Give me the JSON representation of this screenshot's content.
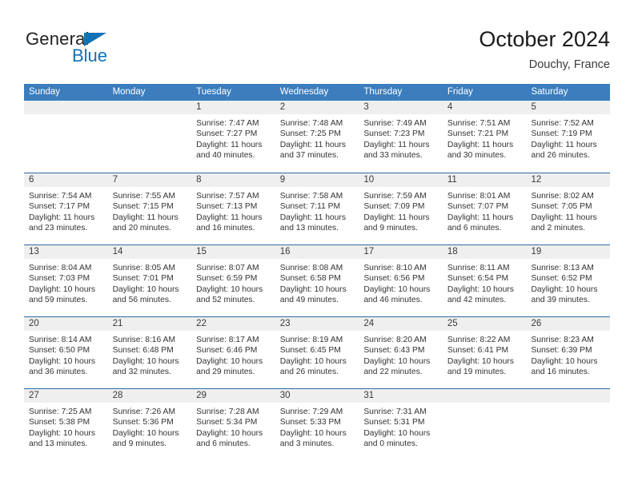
{
  "brand": {
    "name_part1": "General",
    "name_part2": "Blue",
    "accent_color": "#1272b6"
  },
  "header": {
    "title": "October 2024",
    "subtitle": "Douchy, France"
  },
  "theme": {
    "header_blue": "#3b7dbd",
    "row_divider_blue": "#2e6ca4",
    "day_band_gray": "#efefef"
  },
  "weekdays": [
    "Sunday",
    "Monday",
    "Tuesday",
    "Wednesday",
    "Thursday",
    "Friday",
    "Saturday"
  ],
  "weeks": [
    [
      {
        "day": "",
        "lines": []
      },
      {
        "day": "",
        "lines": []
      },
      {
        "day": "1",
        "lines": [
          "Sunrise: 7:47 AM",
          "Sunset: 7:27 PM",
          "Daylight: 11 hours",
          "and 40 minutes."
        ]
      },
      {
        "day": "2",
        "lines": [
          "Sunrise: 7:48 AM",
          "Sunset: 7:25 PM",
          "Daylight: 11 hours",
          "and 37 minutes."
        ]
      },
      {
        "day": "3",
        "lines": [
          "Sunrise: 7:49 AM",
          "Sunset: 7:23 PM",
          "Daylight: 11 hours",
          "and 33 minutes."
        ]
      },
      {
        "day": "4",
        "lines": [
          "Sunrise: 7:51 AM",
          "Sunset: 7:21 PM",
          "Daylight: 11 hours",
          "and 30 minutes."
        ]
      },
      {
        "day": "5",
        "lines": [
          "Sunrise: 7:52 AM",
          "Sunset: 7:19 PM",
          "Daylight: 11 hours",
          "and 26 minutes."
        ]
      }
    ],
    [
      {
        "day": "6",
        "lines": [
          "Sunrise: 7:54 AM",
          "Sunset: 7:17 PM",
          "Daylight: 11 hours",
          "and 23 minutes."
        ]
      },
      {
        "day": "7",
        "lines": [
          "Sunrise: 7:55 AM",
          "Sunset: 7:15 PM",
          "Daylight: 11 hours",
          "and 20 minutes."
        ]
      },
      {
        "day": "8",
        "lines": [
          "Sunrise: 7:57 AM",
          "Sunset: 7:13 PM",
          "Daylight: 11 hours",
          "and 16 minutes."
        ]
      },
      {
        "day": "9",
        "lines": [
          "Sunrise: 7:58 AM",
          "Sunset: 7:11 PM",
          "Daylight: 11 hours",
          "and 13 minutes."
        ]
      },
      {
        "day": "10",
        "lines": [
          "Sunrise: 7:59 AM",
          "Sunset: 7:09 PM",
          "Daylight: 11 hours",
          "and 9 minutes."
        ]
      },
      {
        "day": "11",
        "lines": [
          "Sunrise: 8:01 AM",
          "Sunset: 7:07 PM",
          "Daylight: 11 hours",
          "and 6 minutes."
        ]
      },
      {
        "day": "12",
        "lines": [
          "Sunrise: 8:02 AM",
          "Sunset: 7:05 PM",
          "Daylight: 11 hours",
          "and 2 minutes."
        ]
      }
    ],
    [
      {
        "day": "13",
        "lines": [
          "Sunrise: 8:04 AM",
          "Sunset: 7:03 PM",
          "Daylight: 10 hours",
          "and 59 minutes."
        ]
      },
      {
        "day": "14",
        "lines": [
          "Sunrise: 8:05 AM",
          "Sunset: 7:01 PM",
          "Daylight: 10 hours",
          "and 56 minutes."
        ]
      },
      {
        "day": "15",
        "lines": [
          "Sunrise: 8:07 AM",
          "Sunset: 6:59 PM",
          "Daylight: 10 hours",
          "and 52 minutes."
        ]
      },
      {
        "day": "16",
        "lines": [
          "Sunrise: 8:08 AM",
          "Sunset: 6:58 PM",
          "Daylight: 10 hours",
          "and 49 minutes."
        ]
      },
      {
        "day": "17",
        "lines": [
          "Sunrise: 8:10 AM",
          "Sunset: 6:56 PM",
          "Daylight: 10 hours",
          "and 46 minutes."
        ]
      },
      {
        "day": "18",
        "lines": [
          "Sunrise: 8:11 AM",
          "Sunset: 6:54 PM",
          "Daylight: 10 hours",
          "and 42 minutes."
        ]
      },
      {
        "day": "19",
        "lines": [
          "Sunrise: 8:13 AM",
          "Sunset: 6:52 PM",
          "Daylight: 10 hours",
          "and 39 minutes."
        ]
      }
    ],
    [
      {
        "day": "20",
        "lines": [
          "Sunrise: 8:14 AM",
          "Sunset: 6:50 PM",
          "Daylight: 10 hours",
          "and 36 minutes."
        ]
      },
      {
        "day": "21",
        "lines": [
          "Sunrise: 8:16 AM",
          "Sunset: 6:48 PM",
          "Daylight: 10 hours",
          "and 32 minutes."
        ]
      },
      {
        "day": "22",
        "lines": [
          "Sunrise: 8:17 AM",
          "Sunset: 6:46 PM",
          "Daylight: 10 hours",
          "and 29 minutes."
        ]
      },
      {
        "day": "23",
        "lines": [
          "Sunrise: 8:19 AM",
          "Sunset: 6:45 PM",
          "Daylight: 10 hours",
          "and 26 minutes."
        ]
      },
      {
        "day": "24",
        "lines": [
          "Sunrise: 8:20 AM",
          "Sunset: 6:43 PM",
          "Daylight: 10 hours",
          "and 22 minutes."
        ]
      },
      {
        "day": "25",
        "lines": [
          "Sunrise: 8:22 AM",
          "Sunset: 6:41 PM",
          "Daylight: 10 hours",
          "and 19 minutes."
        ]
      },
      {
        "day": "26",
        "lines": [
          "Sunrise: 8:23 AM",
          "Sunset: 6:39 PM",
          "Daylight: 10 hours",
          "and 16 minutes."
        ]
      }
    ],
    [
      {
        "day": "27",
        "lines": [
          "Sunrise: 7:25 AM",
          "Sunset: 5:38 PM",
          "Daylight: 10 hours",
          "and 13 minutes."
        ]
      },
      {
        "day": "28",
        "lines": [
          "Sunrise: 7:26 AM",
          "Sunset: 5:36 PM",
          "Daylight: 10 hours",
          "and 9 minutes."
        ]
      },
      {
        "day": "29",
        "lines": [
          "Sunrise: 7:28 AM",
          "Sunset: 5:34 PM",
          "Daylight: 10 hours",
          "and 6 minutes."
        ]
      },
      {
        "day": "30",
        "lines": [
          "Sunrise: 7:29 AM",
          "Sunset: 5:33 PM",
          "Daylight: 10 hours",
          "and 3 minutes."
        ]
      },
      {
        "day": "31",
        "lines": [
          "Sunrise: 7:31 AM",
          "Sunset: 5:31 PM",
          "Daylight: 10 hours",
          "and 0 minutes."
        ]
      },
      {
        "day": "",
        "lines": []
      },
      {
        "day": "",
        "lines": []
      }
    ]
  ]
}
